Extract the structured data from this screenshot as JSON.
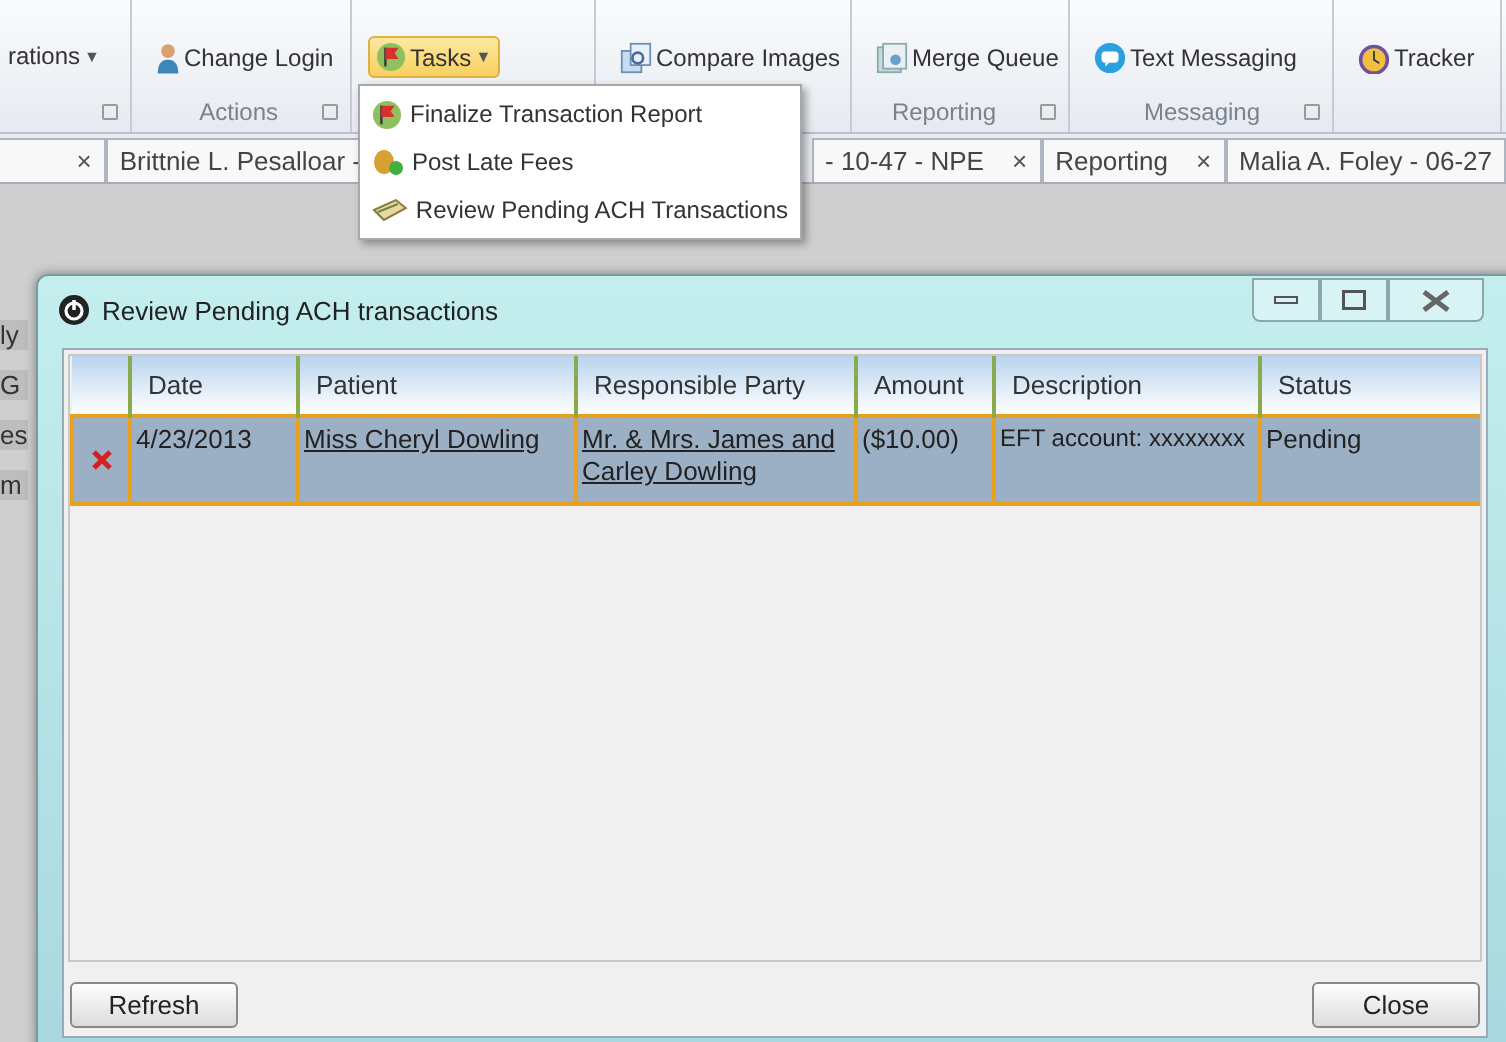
{
  "ribbon": {
    "groups": [
      {
        "launcher": true,
        "items": [
          {
            "text": "rations",
            "caret": "▼",
            "highlighted": false
          }
        ]
      },
      {
        "label": "Actions",
        "launcher": true,
        "items": [
          {
            "text": "Change Login",
            "highlighted": false
          }
        ]
      },
      {
        "launcher": false,
        "items": [
          {
            "text": "Tasks",
            "caret": "▼",
            "highlighted": true
          }
        ]
      },
      {
        "launcher": false,
        "items": [
          {
            "text": "Compare Images",
            "highlighted": false
          }
        ]
      },
      {
        "label": "Reporting",
        "launcher": true,
        "items": [
          {
            "text": "Merge Queue",
            "highlighted": false
          }
        ]
      },
      {
        "label": "Messaging",
        "launcher": true,
        "items": [
          {
            "text": "Text Messaging",
            "highlighted": false
          }
        ]
      },
      {
        "launcher": false,
        "items": [
          {
            "text": "Tracker",
            "highlighted": false
          }
        ]
      }
    ]
  },
  "tasks_menu": [
    {
      "text": "Finalize Transaction Report"
    },
    {
      "text": "Post Late Fees"
    },
    {
      "text": "Review Pending ACH Transactions"
    }
  ],
  "doc_tabs": [
    {
      "close": "×"
    },
    {
      "text": "Brittnie L. Pesalloar -"
    },
    {
      "text": "- 10-47 - NPE",
      "close": "×"
    },
    {
      "text": "Reporting",
      "close": "×"
    },
    {
      "text": "Malia A. Foley - 06-27"
    }
  ],
  "background_fragments": [
    "ly",
    "G",
    "es",
    "m"
  ],
  "dialog": {
    "title": "Review Pending ACH transactions",
    "columns": [
      "Date",
      "Patient",
      "Responsible Party",
      "Amount",
      "Description",
      "Status"
    ],
    "rows": [
      {
        "selected": true,
        "date": "4/23/2013",
        "patient": "Miss Cheryl Dowling",
        "responsible_party": "Mr. & Mrs. James and Carley Dowling",
        "amount": "($10.00)",
        "description": "EFT account: xxxxxxxx",
        "status": "Pending"
      }
    ],
    "buttons": {
      "left": "Refresh",
      "right": "Close"
    }
  }
}
